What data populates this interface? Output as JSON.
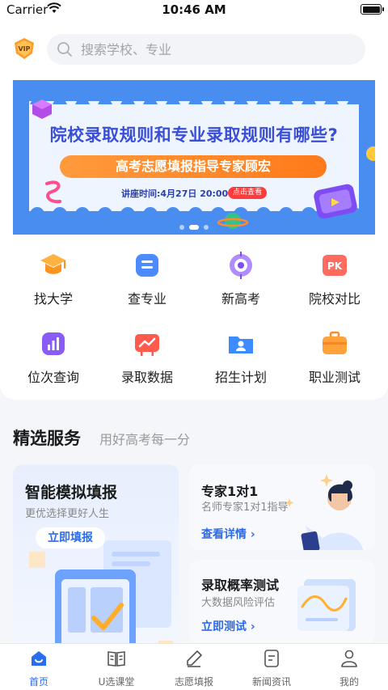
{
  "status_bar": {
    "carrier": "Carrier",
    "time": "10:46 AM"
  },
  "header": {
    "vip_label": "VIP",
    "search_placeholder": "搜索学校、专业"
  },
  "banner": {
    "headline": "院校录取规则和专业录取规则有哪些?",
    "pill": "高考志愿填报指导专家顾宏",
    "lecture_time": "讲座时间:4月27日 20:00",
    "click_tag": "点击查看",
    "slide_count": 3,
    "active_slide": 1
  },
  "grid": [
    {
      "label": "找大学",
      "icon": "graduation-cap-icon"
    },
    {
      "label": "查专业",
      "icon": "list-icon"
    },
    {
      "label": "新高考",
      "icon": "compass-icon"
    },
    {
      "label": "院校对比",
      "icon": "pk-icon"
    },
    {
      "label": "位次查询",
      "icon": "bar-chart-icon"
    },
    {
      "label": "录取数据",
      "icon": "trend-board-icon"
    },
    {
      "label": "招生计划",
      "icon": "folder-person-icon"
    },
    {
      "label": "职业测试",
      "icon": "briefcase-icon"
    }
  ],
  "services": {
    "title": "精选服务",
    "subtitle": "用好高考每一分",
    "big_card": {
      "title": "智能模拟填报",
      "subtitle": "更优选择更好人生",
      "button": "立即填报"
    },
    "card_expert": {
      "title": "专家1对1",
      "subtitle": "名师专家1对1指导",
      "link": "查看详情 ›"
    },
    "card_prob": {
      "title": "录取概率测试",
      "subtitle": "大数据风险评估",
      "link": "立即测试 ›"
    }
  },
  "tabs": [
    {
      "label": "首页",
      "icon": "home-icon",
      "active": true
    },
    {
      "label": "U选课堂",
      "icon": "book-icon",
      "active": false
    },
    {
      "label": "志愿填报",
      "icon": "pen-icon",
      "active": false
    },
    {
      "label": "新闻资讯",
      "icon": "news-icon",
      "active": false
    },
    {
      "label": "我的",
      "icon": "user-icon",
      "active": false
    }
  ],
  "colors": {
    "accent": "#2a6cf0",
    "orange": "#ff8a2a",
    "banner_blue": "#4a8df0"
  }
}
